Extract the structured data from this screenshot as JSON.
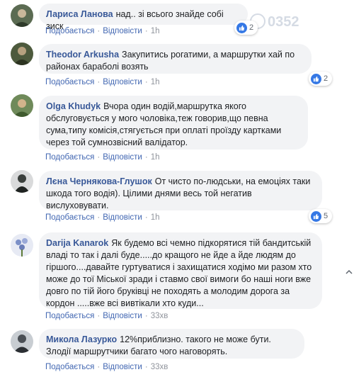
{
  "actions": {
    "like": "Подобається",
    "reply": "Відповісти",
    "sep": "·"
  },
  "watermark": {
    "text": "0352"
  },
  "comments": [
    {
      "author": "Лариса Ланова",
      "text": "над.. зі всього знайде собі зиск",
      "time": "1h",
      "reactions": "2",
      "avatar_bg": "#5b6b52"
    },
    {
      "author": "Theodor Arkusha",
      "text": "Закупитись рогатими, а маршрутки хай по районах бараболі возять",
      "time": "1h",
      "reactions": "2",
      "avatar_bg": "#4d5a3d"
    },
    {
      "author": "Olga Khudyk",
      "text": "Вчора один водій,маршрутка якого обслуговується у мого чоловіка,теж говорив,що певна сума,типу комісія,стягується при оплаті проїзду картками через той сумнозвісний валідатор.",
      "time": "1h",
      "reactions": "",
      "avatar_bg": "#6f8a5a"
    },
    {
      "author": "Лєна Чернякова-Глушок",
      "text": "От чисто по-людськи, на емоціях таки шкода того водія). Цілими днями весь той негатив вислуховувати.",
      "time": "1h",
      "reactions": "5",
      "avatar_bg": "#3a3f3c"
    },
    {
      "author": "Darija Kanarok",
      "text": "Як будемо всі чемно підкорятися тій бандитській владі то так і далі буде.....до кращого не йде а йде людям до гіршого....давайте гуртуватися і захищатися ходімо ми разом хто може до тої Міської зради і ставмо свої вимоги бо наші ноги вже довго по тій його бруківці не походять а молодим дорога за кордон .....вже всі вивтікали хто куди...",
      "time": "33хв",
      "reactions": "",
      "avatar_bg": "#7b8fc7"
    },
    {
      "author": "Микола Лазурко",
      "text": "12%приблизно. такого не може бути. Злодії маршрутчики багато чого наговорять.",
      "time": "33хв",
      "reactions": "",
      "avatar_bg": "#4a4f55"
    }
  ]
}
